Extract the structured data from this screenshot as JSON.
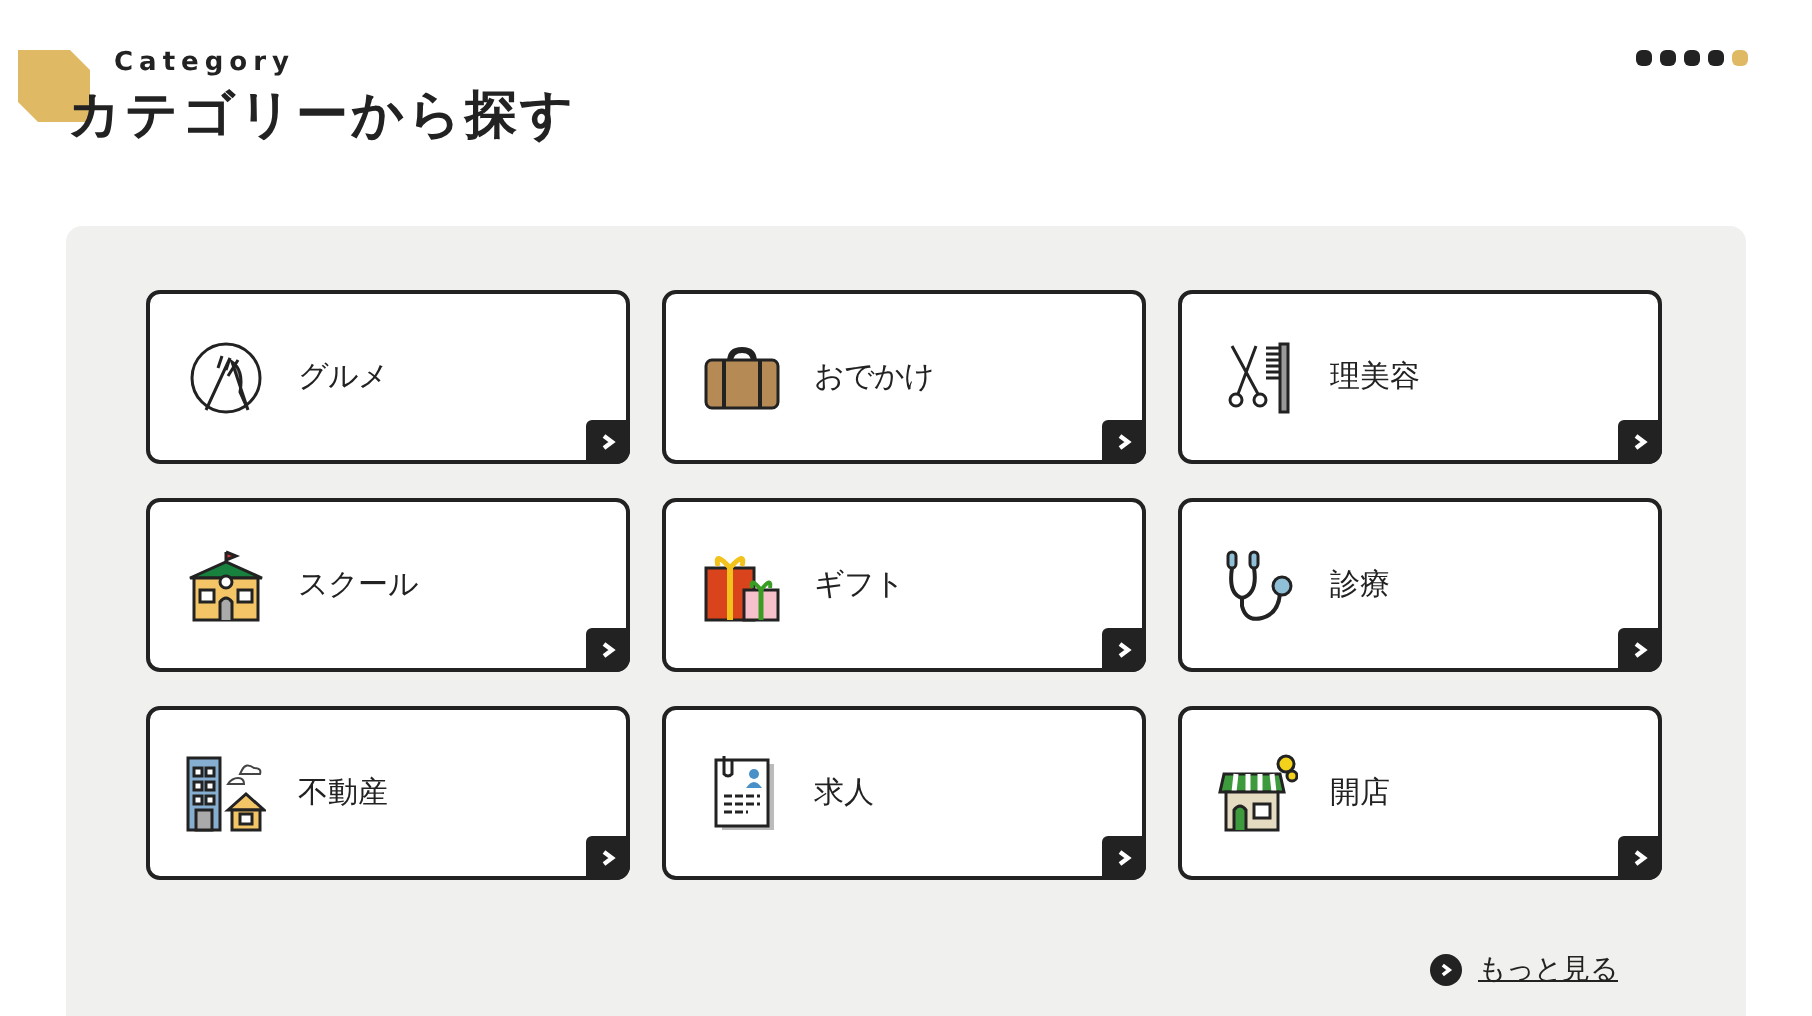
{
  "heading": {
    "eyebrow": "Category",
    "title": "カテゴリーから探す"
  },
  "pager": [
    {
      "selected": false
    },
    {
      "selected": false
    },
    {
      "selected": false
    },
    {
      "selected": false
    },
    {
      "selected": true
    }
  ],
  "categories": [
    {
      "label": "グルメ"
    },
    {
      "label": "おでかけ"
    },
    {
      "label": "理美容"
    },
    {
      "label": "スクール"
    },
    {
      "label": "ギフト"
    },
    {
      "label": "診療"
    },
    {
      "label": "不動産"
    },
    {
      "label": "求人"
    },
    {
      "label": "開店"
    }
  ],
  "more_link": {
    "label": "もっと見る"
  }
}
